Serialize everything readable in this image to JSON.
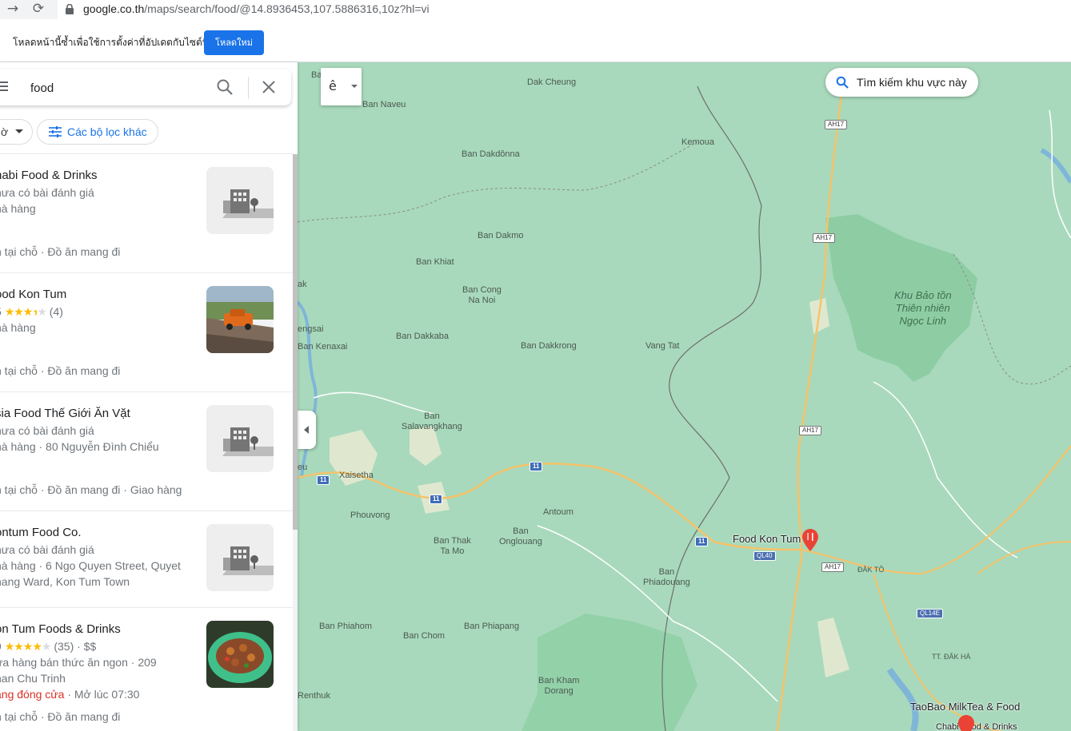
{
  "browser": {
    "url_domain": "google.co.th",
    "url_path": "/maps/search/food/@14.8936453,107.5886316,10z?hl=vi"
  },
  "banner": {
    "message": "โหลดหน้านี้ซ้ำเพื่อใช้การตั้งค่าที่อัปเดตกับไซต์นี้",
    "button_label": "โหลดใหม่"
  },
  "search": {
    "query": "food"
  },
  "filters": {
    "hours_label": "ờ",
    "more_filters_label": "Các bộ lọc khác"
  },
  "results": [
    {
      "title": "habi Food & Drinks",
      "line1": "hưa có bài đánh giá",
      "line2": "hà hàng",
      "line3": "",
      "services": "n tại chỗ · Đồ ăn mang đi",
      "thumb": "placeholder-building"
    },
    {
      "title": "ood Kon Tum",
      "rating_text": "5",
      "stars": 3.5,
      "review_count": "(4)",
      "line2": "hà hàng",
      "services": "n tại chỗ · Đồ ăn mang đi",
      "thumb": "photo-orange-truck"
    },
    {
      "title": "sia Food Thế Giới Ăn Vặt",
      "line1": "hưa có bài đánh giá",
      "line2": "hà hàng · 80 Nguyễn Đình Chiểu",
      "services": "n tại chỗ · Đồ ăn mang đi · Giao hàng",
      "thumb": "placeholder-building"
    },
    {
      "title": "ontum Food Co.",
      "line1": "hưa có bài đánh giá",
      "line2": "hà hàng · 6 Ngo Quyen Street, Quyet",
      "line3": "hang Ward, Kon Tum Town",
      "thumb": "placeholder-building"
    },
    {
      "title": "on Tum Foods & Drinks",
      "rating_text": "9",
      "stars": 4,
      "review_count": "(35) · $$",
      "line2": "ửa hàng bán thức ăn ngon · 209",
      "line3": "han Chu Trinh",
      "status_closed": "ang đóng cửa",
      "status_open": " · Mở lúc 07:30",
      "services": "n tại chỗ · Đồ ăn mang đi",
      "thumb": "photo-food-plate"
    }
  ],
  "map": {
    "search_area_label": "Tìm kiếm khu vực này",
    "layer_glyph": "ê",
    "park_name": [
      "Khu Bảo tồn",
      "Thiên nhiên",
      "Ngọc Linh"
    ],
    "poi_primary": "Food Kon Tum",
    "poi_secondary": "TaoBao MilkTea & Food",
    "poi_tertiary": "Chabi Food & Drinks",
    "places": [
      {
        "label": "Ban",
        "pos": "a"
      },
      {
        "label": "Dak Cheung"
      },
      {
        "label": "Ban Naveu"
      },
      {
        "label": "Kemoua"
      },
      {
        "label": "Ban Dakdônna"
      },
      {
        "label": "Ban Dakmo"
      },
      {
        "label": "Ban Khiat"
      },
      {
        "label": "Ban Cong"
      },
      {
        "label": "Na Noi"
      },
      {
        "label": "Ban Dakkaba"
      },
      {
        "label": "Ban Dakkrong"
      },
      {
        "label": "Vang Tat"
      },
      {
        "label": "Ban Kenaxai"
      },
      {
        "label": "engsai"
      },
      {
        "label": "ak"
      },
      {
        "label": "Ban"
      },
      {
        "label": "Salavangkhang"
      },
      {
        "label": "Xaisetha"
      },
      {
        "label": "eu"
      },
      {
        "label": "Phouvong"
      },
      {
        "label": "Antoum"
      },
      {
        "label": "Ban"
      },
      {
        "label": "Onglouang"
      },
      {
        "label": "Ban Thak"
      },
      {
        "label": "Ta Mo"
      },
      {
        "label": "Ban"
      },
      {
        "label": "Phiadouang"
      },
      {
        "label": "Ban Phiahom"
      },
      {
        "label": "Ban Phiapang"
      },
      {
        "label": "Ban Chom"
      },
      {
        "label": "Ban Kham"
      },
      {
        "label": "Dorang"
      },
      {
        "label": "Renthuk"
      },
      {
        "label": "ĐĂK TÔ"
      },
      {
        "label": "TT. ĐĂK HÀ"
      }
    ],
    "shields": [
      "AH17",
      "AH17",
      "AH17",
      "AH17",
      "11",
      "11",
      "11",
      "11",
      "QL40",
      "QL14E"
    ]
  },
  "colors": {
    "accent": "#1a73e8",
    "map_bg": "#a8d9bc",
    "road_major": "#f5c36b",
    "road_minor": "#ffffff",
    "pin": "#ea4335"
  }
}
